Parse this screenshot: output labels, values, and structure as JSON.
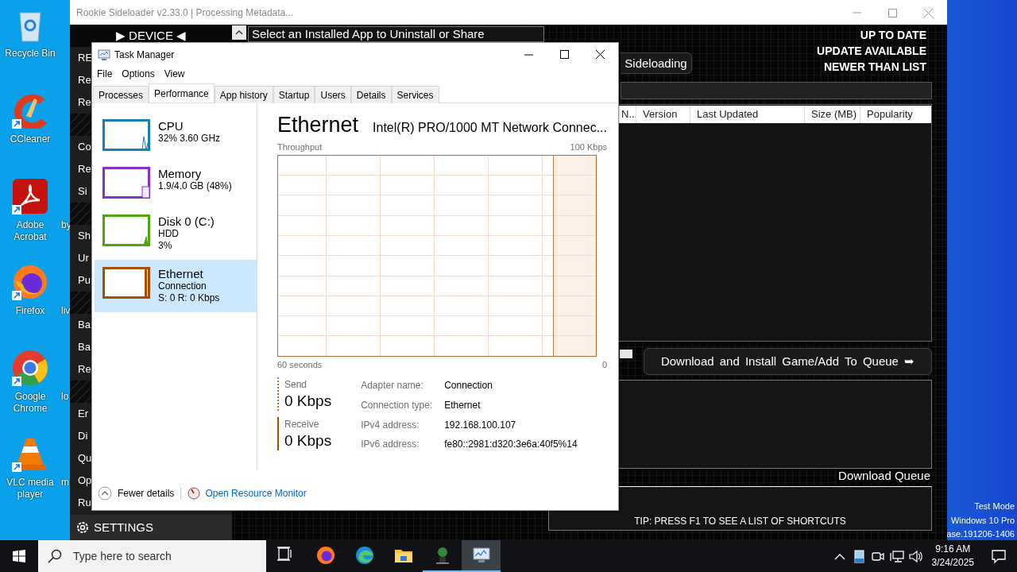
{
  "desktop": {
    "icons": [
      {
        "kind": "recycle",
        "label": "Recycle Bin",
        "shortcut": false
      },
      {
        "kind": "ccleaner",
        "label": "CCleaner",
        "shortcut": true
      },
      {
        "kind": "acrobat",
        "label": "Adobe Acrobat",
        "shortcut": true
      },
      {
        "kind": "firefox",
        "label": "Firefox",
        "shortcut": true
      },
      {
        "kind": "chrome",
        "label": "Google Chrome",
        "shortcut": true
      },
      {
        "kind": "vlc",
        "label": "VLC media player",
        "shortcut": true
      }
    ],
    "hidden_icon_labels": [
      "by",
      "liv",
      "lo",
      "m"
    ],
    "system_text": [
      "Test Mode",
      "Windows 10 Pro",
      "ase.191206-1406"
    ]
  },
  "rookie": {
    "title": "Rookie Sideloader v2.33.0 | Processing Metadata...",
    "device_header": "▶ DEVICE ◀",
    "menu_sections": [
      [
        "RE",
        "Re",
        "Re"
      ],
      [
        "Co",
        "Re",
        "Si"
      ],
      [
        "Sh",
        "Ur",
        "Pu"
      ],
      [
        "Ba",
        "Ba",
        "Re"
      ],
      [
        "Er",
        "Di",
        "Qu",
        "Op",
        "Ru"
      ]
    ],
    "settings": "SETTINGS",
    "select_box": "Select an Installed App to Uninstall or Share",
    "sideloading_button": "Sideloading",
    "status_legend": [
      "UP TO DATE",
      "UPDATE AVAILABLE",
      "NEWER THAN LIST"
    ],
    "table": {
      "columns": [
        "N...",
        "Version",
        "Last Updated",
        "Size (MB)",
        "Popularity"
      ]
    },
    "download_button": "Download and Install Game/Add To Queue ➥",
    "queue_label": "Download Queue",
    "tip": "TIP: PRESS F1 TO SEE A LIST OF SHORTCUTS"
  },
  "task_manager": {
    "title": "Task Manager",
    "menu": [
      "File",
      "Options",
      "View"
    ],
    "tabs": [
      {
        "label": "Processes",
        "selected": false
      },
      {
        "label": "Performance",
        "selected": true
      },
      {
        "label": "App history",
        "selected": false
      },
      {
        "label": "Startup",
        "selected": false
      },
      {
        "label": "Users",
        "selected": false
      },
      {
        "label": "Details",
        "selected": false
      },
      {
        "label": "Services",
        "selected": false
      }
    ],
    "resources": [
      {
        "kind": "cpu",
        "color": "#1b7cb8",
        "title": "CPU",
        "lines": [
          "32% 3.60 GHz"
        ],
        "selected": false
      },
      {
        "kind": "memory",
        "color": "#8b2fc9",
        "title": "Memory",
        "lines": [
          "1.9/4.0 GB (48%)"
        ],
        "selected": false
      },
      {
        "kind": "disk",
        "color": "#4da60c",
        "title": "Disk 0 (C:)",
        "lines": [
          "HDD",
          "3%"
        ],
        "selected": false
      },
      {
        "kind": "ethernet",
        "color": "#a74f01",
        "title": "Ethernet",
        "lines": [
          "Connection",
          "S: 0 R: 0 Kbps"
        ],
        "selected": true
      }
    ],
    "detail": {
      "title": "Ethernet",
      "subtitle": "Intel(R) PRO/1000 MT Network Connec...",
      "graph_label": "Throughput",
      "graph_max": "100 Kbps",
      "graph_span": "60 seconds",
      "graph_min": "0",
      "send_label": "Send",
      "send_value": "0 Kbps",
      "receive_label": "Receive",
      "receive_value": "0 Kbps",
      "properties": [
        {
          "key": "Adapter name:",
          "value": "Connection"
        },
        {
          "key": "Connection type:",
          "value": "Ethernet"
        },
        {
          "key": "IPv4 address:",
          "value": "192.168.100.107"
        },
        {
          "key": "IPv6 address:",
          "value": "fe80::2981:d320:3e6a:40f5%14"
        }
      ]
    },
    "fewer_details": "Fewer details",
    "resource_monitor": "Open Resource Monitor"
  },
  "taskbar": {
    "search": {
      "placeholder": "Type here to search"
    },
    "apps": [
      {
        "kind": "taskview",
        "running": false,
        "selected": false
      },
      {
        "kind": "firefox",
        "running": false,
        "selected": false
      },
      {
        "kind": "edge",
        "running": false,
        "selected": false
      },
      {
        "kind": "explorer",
        "running": false,
        "selected": false
      },
      {
        "kind": "rookie",
        "running": true,
        "selected": false
      },
      {
        "kind": "taskmgr",
        "running": true,
        "selected": true
      }
    ],
    "time": "9:16 AM",
    "date": "3/24/2025"
  }
}
